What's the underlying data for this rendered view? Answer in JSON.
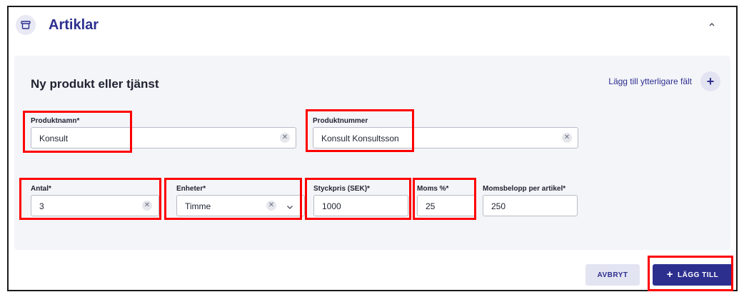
{
  "header": {
    "title": "Artiklar",
    "icon": "archive-box-icon",
    "collapse_icon": "chevron-up-icon"
  },
  "form": {
    "title": "Ny produkt eller tjänst",
    "add_field_label": "Lägg till ytterligare fält",
    "add_field_icon": "plus-icon"
  },
  "fields": {
    "product_name": {
      "label": "Produktnamn*",
      "value": "Konsult"
    },
    "product_number": {
      "label": "Produktnummer",
      "value": "Konsult Konsultsson"
    },
    "quantity": {
      "label": "Antal*",
      "value": "3"
    },
    "unit": {
      "label": "Enheter*",
      "value": "Timme"
    },
    "unit_price": {
      "label": "Styckpris (SEK)*",
      "value": "1000"
    },
    "vat_percent": {
      "label": "Moms %*",
      "value": "25"
    },
    "vat_amount": {
      "label": "Momsbelopp per artikel*",
      "value": "250"
    }
  },
  "actions": {
    "cancel_label": "AVBRYT",
    "add_label": "LÄGG TILL",
    "add_icon": "+"
  },
  "colors": {
    "accent": "#2d2f8f",
    "highlight": "#ff0000",
    "panel_bg": "#f4f5f9"
  }
}
